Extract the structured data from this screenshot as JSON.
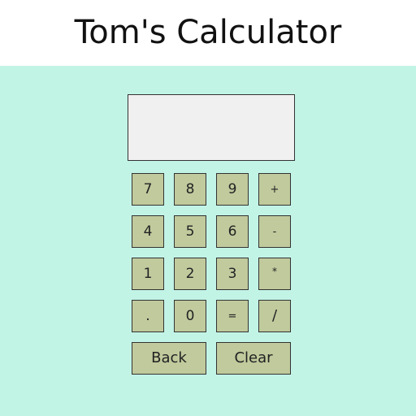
{
  "header": {
    "title": "Tom's Calculator"
  },
  "display": {
    "value": ""
  },
  "keys": {
    "k7": "7",
    "k8": "8",
    "k9": "9",
    "plus": "+",
    "k4": "4",
    "k5": "5",
    "k6": "6",
    "minus": "-",
    "k1": "1",
    "k2": "2",
    "k3": "3",
    "multiply": "*",
    "dot": ".",
    "k0": "0",
    "equals": "=",
    "divide": "/",
    "back": "Back",
    "clear": "Clear"
  },
  "colors": {
    "background": "#c2f4e6",
    "header_background": "#ffffff",
    "display_background": "#f0f0f0",
    "key_background": "#c0ca9d"
  }
}
